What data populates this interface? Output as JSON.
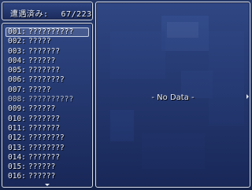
{
  "header": {
    "label": "遭遇済み:",
    "count": "67/223"
  },
  "list": {
    "items": [
      {
        "num": "001:",
        "name": "??????????"
      },
      {
        "num": "002:",
        "name": "?????"
      },
      {
        "num": "003:",
        "name": "???????"
      },
      {
        "num": "004:",
        "name": "??????"
      },
      {
        "num": "005:",
        "name": "???????"
      },
      {
        "num": "006:",
        "name": "????????"
      },
      {
        "num": "007:",
        "name": "?????"
      },
      {
        "num": "008:",
        "name": "??????????"
      },
      {
        "num": "009:",
        "name": "??????"
      },
      {
        "num": "010:",
        "name": "???????"
      },
      {
        "num": "011:",
        "name": "???????"
      },
      {
        "num": "012:",
        "name": "????????"
      },
      {
        "num": "013:",
        "name": "????????"
      },
      {
        "num": "014:",
        "name": "???????"
      },
      {
        "num": "015:",
        "name": "??????"
      },
      {
        "num": "016:",
        "name": "??????"
      }
    ]
  },
  "detail": {
    "empty_text": "- No Data -"
  },
  "colors": {
    "window_border": "#d7deec",
    "text": "#e8ecf4",
    "background": "#0c1733"
  }
}
